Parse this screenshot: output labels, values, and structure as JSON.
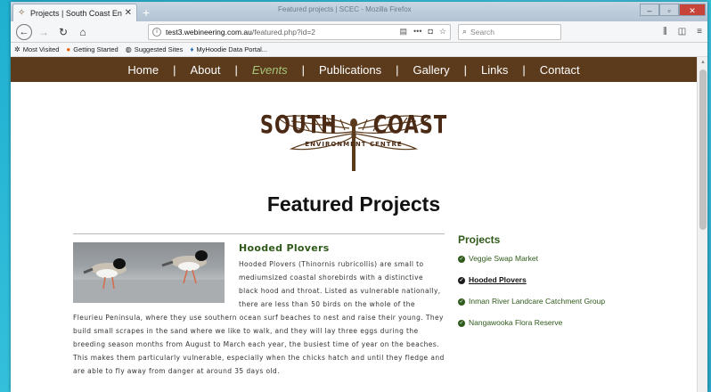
{
  "browser": {
    "tab_title": "Projects | South Coast Environ",
    "window_title": "Featured projects | SCEC - Mozilla Firefox",
    "url_host": "test3.webineering.com.au",
    "url_path": "/featured.php?id=2",
    "search_placeholder": "Search",
    "bookmarks": [
      "Most Visited",
      "Getting Started",
      "Suggested Sites",
      "MyHoodie Data Portal..."
    ]
  },
  "site": {
    "nav": [
      "Home",
      "About",
      "Events",
      "Publications",
      "Gallery",
      "Links",
      "Contact"
    ],
    "active_nav": "Events",
    "logo_line1_left": "SOUTH",
    "logo_line1_right": "COAST",
    "logo_line2": "ENVIRONMENT CENTRE",
    "heading": "Featured Projects"
  },
  "article": {
    "title": "Hooded Plovers",
    "body": "Hooded Plovers (Thinornis rubricollis) are small to mediumsized coastal shorebirds with a distinctive black hood and throat. Listed as vulnerable nationally, there are less than 50 birds on the whole of the Fleurieu Peninsula, where they use southern ocean surf beaches to nest and raise their young. They build small scrapes in the sand where we like to walk, and they will lay three eggs during the breeding season months from August to March each year, the busiest time of year on the beaches. This makes them particularly vulnerable, especially when the chicks hatch and until they fledge and are able to fly away from danger at around 35 days old."
  },
  "sidebar": {
    "title": "Projects",
    "items": [
      "Veggie Swap Market",
      "Hooded Plovers",
      "Inman River Landcare Catchment Group",
      "Nangawooka Flora Reserve"
    ],
    "active": "Hooded Plovers"
  },
  "colors": {
    "nav_bg": "#5c3a1c",
    "active_nav": "#a6c77a",
    "green_text": "#2f5a1a"
  }
}
